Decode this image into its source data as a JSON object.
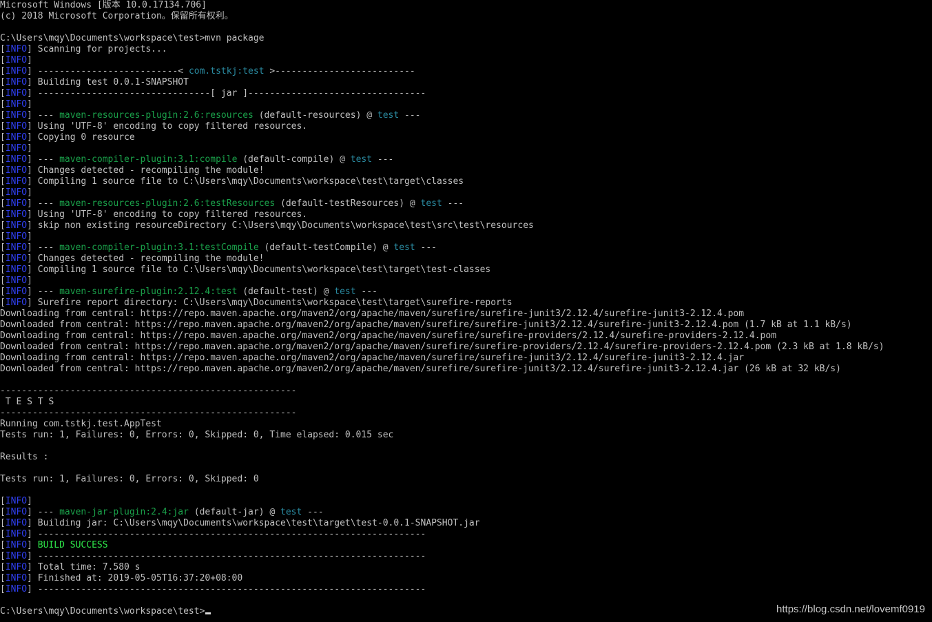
{
  "window": {
    "watermark": "https://blog.csdn.net/lovemf0919"
  },
  "colors": {
    "background": "#000000",
    "text": "#c0c0c0",
    "info": "#2f3ff0",
    "plugin": "#1aa14a",
    "project": "#2a8aa0",
    "success": "#2ee84a"
  },
  "console": {
    "lines": [
      [
        [
          "plain",
          "Microsoft Windows [版本 10.0.17134.706]"
        ]
      ],
      [
        [
          "plain",
          "(c) 2018 Microsoft Corporation。保留所有权利。"
        ]
      ],
      [],
      [
        [
          "plain",
          "C:\\Users\\mqy\\Documents\\workspace\\test>mvn package"
        ]
      ],
      [
        [
          "plain",
          "["
        ],
        [
          "info",
          "INFO"
        ],
        [
          "plain",
          "] Scanning for projects..."
        ]
      ],
      [
        [
          "plain",
          "["
        ],
        [
          "info",
          "INFO"
        ],
        [
          "plain",
          "]"
        ]
      ],
      [
        [
          "plain",
          "["
        ],
        [
          "info",
          "INFO"
        ],
        [
          "plain",
          "] --------------------------< "
        ],
        [
          "cyan",
          "com.tstkj:test"
        ],
        [
          "plain",
          " >--------------------------"
        ]
      ],
      [
        [
          "plain",
          "["
        ],
        [
          "info",
          "INFO"
        ],
        [
          "plain",
          "] Building test 0.0.1-SNAPSHOT"
        ]
      ],
      [
        [
          "plain",
          "["
        ],
        [
          "info",
          "INFO"
        ],
        [
          "plain",
          "] --------------------------------[ jar ]---------------------------------"
        ]
      ],
      [
        [
          "plain",
          "["
        ],
        [
          "info",
          "INFO"
        ],
        [
          "plain",
          "]"
        ]
      ],
      [
        [
          "plain",
          "["
        ],
        [
          "info",
          "INFO"
        ],
        [
          "plain",
          "] --- "
        ],
        [
          "green",
          "maven-resources-plugin:2.6:resources"
        ],
        [
          "plain",
          " (default-resources) @ "
        ],
        [
          "cyan",
          "test"
        ],
        [
          "plain",
          " ---"
        ]
      ],
      [
        [
          "plain",
          "["
        ],
        [
          "info",
          "INFO"
        ],
        [
          "plain",
          "] Using 'UTF-8' encoding to copy filtered resources."
        ]
      ],
      [
        [
          "plain",
          "["
        ],
        [
          "info",
          "INFO"
        ],
        [
          "plain",
          "] Copying 0 resource"
        ]
      ],
      [
        [
          "plain",
          "["
        ],
        [
          "info",
          "INFO"
        ],
        [
          "plain",
          "]"
        ]
      ],
      [
        [
          "plain",
          "["
        ],
        [
          "info",
          "INFO"
        ],
        [
          "plain",
          "] --- "
        ],
        [
          "green",
          "maven-compiler-plugin:3.1:compile"
        ],
        [
          "plain",
          " (default-compile) @ "
        ],
        [
          "cyan",
          "test"
        ],
        [
          "plain",
          " ---"
        ]
      ],
      [
        [
          "plain",
          "["
        ],
        [
          "info",
          "INFO"
        ],
        [
          "plain",
          "] Changes detected - recompiling the module!"
        ]
      ],
      [
        [
          "plain",
          "["
        ],
        [
          "info",
          "INFO"
        ],
        [
          "plain",
          "] Compiling 1 source file to C:\\Users\\mqy\\Documents\\workspace\\test\\target\\classes"
        ]
      ],
      [
        [
          "plain",
          "["
        ],
        [
          "info",
          "INFO"
        ],
        [
          "plain",
          "]"
        ]
      ],
      [
        [
          "plain",
          "["
        ],
        [
          "info",
          "INFO"
        ],
        [
          "plain",
          "] --- "
        ],
        [
          "green",
          "maven-resources-plugin:2.6:testResources"
        ],
        [
          "plain",
          " (default-testResources) @ "
        ],
        [
          "cyan",
          "test"
        ],
        [
          "plain",
          " ---"
        ]
      ],
      [
        [
          "plain",
          "["
        ],
        [
          "info",
          "INFO"
        ],
        [
          "plain",
          "] Using 'UTF-8' encoding to copy filtered resources."
        ]
      ],
      [
        [
          "plain",
          "["
        ],
        [
          "info",
          "INFO"
        ],
        [
          "plain",
          "] skip non existing resourceDirectory C:\\Users\\mqy\\Documents\\workspace\\test\\src\\test\\resources"
        ]
      ],
      [
        [
          "plain",
          "["
        ],
        [
          "info",
          "INFO"
        ],
        [
          "plain",
          "]"
        ]
      ],
      [
        [
          "plain",
          "["
        ],
        [
          "info",
          "INFO"
        ],
        [
          "plain",
          "] --- "
        ],
        [
          "green",
          "maven-compiler-plugin:3.1:testCompile"
        ],
        [
          "plain",
          " (default-testCompile) @ "
        ],
        [
          "cyan",
          "test"
        ],
        [
          "plain",
          " ---"
        ]
      ],
      [
        [
          "plain",
          "["
        ],
        [
          "info",
          "INFO"
        ],
        [
          "plain",
          "] Changes detected - recompiling the module!"
        ]
      ],
      [
        [
          "plain",
          "["
        ],
        [
          "info",
          "INFO"
        ],
        [
          "plain",
          "] Compiling 1 source file to C:\\Users\\mqy\\Documents\\workspace\\test\\target\\test-classes"
        ]
      ],
      [
        [
          "plain",
          "["
        ],
        [
          "info",
          "INFO"
        ],
        [
          "plain",
          "]"
        ]
      ],
      [
        [
          "plain",
          "["
        ],
        [
          "info",
          "INFO"
        ],
        [
          "plain",
          "] --- "
        ],
        [
          "green",
          "maven-surefire-plugin:2.12.4:test"
        ],
        [
          "plain",
          " (default-test) @ "
        ],
        [
          "cyan",
          "test"
        ],
        [
          "plain",
          " ---"
        ]
      ],
      [
        [
          "plain",
          "["
        ],
        [
          "info",
          "INFO"
        ],
        [
          "plain",
          "] Surefire report directory: C:\\Users\\mqy\\Documents\\workspace\\test\\target\\surefire-reports"
        ]
      ],
      [
        [
          "plain",
          "Downloading from central: https://repo.maven.apache.org/maven2/org/apache/maven/surefire/surefire-junit3/2.12.4/surefire-junit3-2.12.4.pom"
        ]
      ],
      [
        [
          "plain",
          "Downloaded from central: https://repo.maven.apache.org/maven2/org/apache/maven/surefire/surefire-junit3/2.12.4/surefire-junit3-2.12.4.pom (1.7 kB at 1.1 kB/s)"
        ]
      ],
      [
        [
          "plain",
          "Downloading from central: https://repo.maven.apache.org/maven2/org/apache/maven/surefire/surefire-providers/2.12.4/surefire-providers-2.12.4.pom"
        ]
      ],
      [
        [
          "plain",
          "Downloaded from central: https://repo.maven.apache.org/maven2/org/apache/maven/surefire/surefire-providers/2.12.4/surefire-providers-2.12.4.pom (2.3 kB at 1.8 kB/s)"
        ]
      ],
      [
        [
          "plain",
          "Downloading from central: https://repo.maven.apache.org/maven2/org/apache/maven/surefire/surefire-junit3/2.12.4/surefire-junit3-2.12.4.jar"
        ]
      ],
      [
        [
          "plain",
          "Downloaded from central: https://repo.maven.apache.org/maven2/org/apache/maven/surefire/surefire-junit3/2.12.4/surefire-junit3-2.12.4.jar (26 kB at 32 kB/s)"
        ]
      ],
      [],
      [
        [
          "plain",
          "-------------------------------------------------------"
        ]
      ],
      [
        [
          "plain",
          " T E S T S"
        ]
      ],
      [
        [
          "plain",
          "-------------------------------------------------------"
        ]
      ],
      [
        [
          "plain",
          "Running com.tstkj.test.AppTest"
        ]
      ],
      [
        [
          "plain",
          "Tests run: 1, Failures: 0, Errors: 0, Skipped: 0, Time elapsed: 0.015 sec"
        ]
      ],
      [],
      [
        [
          "plain",
          "Results :"
        ]
      ],
      [],
      [
        [
          "plain",
          "Tests run: 1, Failures: 0, Errors: 0, Skipped: 0"
        ]
      ],
      [],
      [
        [
          "plain",
          "["
        ],
        [
          "info",
          "INFO"
        ],
        [
          "plain",
          "]"
        ]
      ],
      [
        [
          "plain",
          "["
        ],
        [
          "info",
          "INFO"
        ],
        [
          "plain",
          "] --- "
        ],
        [
          "green",
          "maven-jar-plugin:2.4:jar"
        ],
        [
          "plain",
          " (default-jar) @ "
        ],
        [
          "cyan",
          "test"
        ],
        [
          "plain",
          " ---"
        ]
      ],
      [
        [
          "plain",
          "["
        ],
        [
          "info",
          "INFO"
        ],
        [
          "plain",
          "] Building jar: C:\\Users\\mqy\\Documents\\workspace\\test\\target\\test-0.0.1-SNAPSHOT.jar"
        ]
      ],
      [
        [
          "plain",
          "["
        ],
        [
          "info",
          "INFO"
        ],
        [
          "plain",
          "] ------------------------------------------------------------------------"
        ]
      ],
      [
        [
          "plain",
          "["
        ],
        [
          "info",
          "INFO"
        ],
        [
          "plain",
          "] "
        ],
        [
          "success",
          "BUILD SUCCESS"
        ]
      ],
      [
        [
          "plain",
          "["
        ],
        [
          "info",
          "INFO"
        ],
        [
          "plain",
          "] ------------------------------------------------------------------------"
        ]
      ],
      [
        [
          "plain",
          "["
        ],
        [
          "info",
          "INFO"
        ],
        [
          "plain",
          "] Total time: 7.580 s"
        ]
      ],
      [
        [
          "plain",
          "["
        ],
        [
          "info",
          "INFO"
        ],
        [
          "plain",
          "] Finished at: 2019-05-05T16:37:20+08:00"
        ]
      ],
      [
        [
          "plain",
          "["
        ],
        [
          "info",
          "INFO"
        ],
        [
          "plain",
          "] ------------------------------------------------------------------------"
        ]
      ],
      [],
      [
        [
          "plain",
          "C:\\Users\\mqy\\Documents\\workspace\\test>"
        ],
        [
          "cursor",
          ""
        ]
      ]
    ]
  }
}
